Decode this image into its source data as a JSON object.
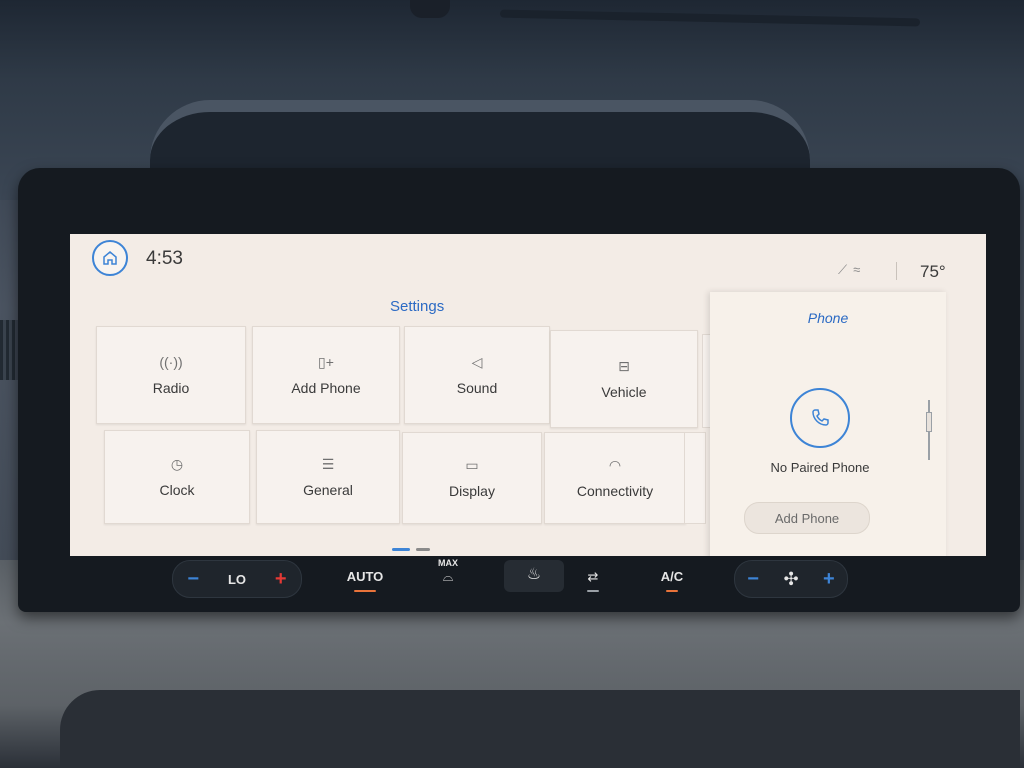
{
  "status_bar": {
    "time": "4:53",
    "temperature": "75°"
  },
  "settings": {
    "title": "Settings",
    "tiles": [
      {
        "label": "Radio",
        "icon": "radio-antenna-icon"
      },
      {
        "label": "Add Phone",
        "icon": "add-phone-icon"
      },
      {
        "label": "Sound",
        "icon": "speaker-icon"
      },
      {
        "label": "Vehicle",
        "icon": "vehicle-icon"
      },
      {
        "label": "Clock",
        "icon": "clock-icon"
      },
      {
        "label": "General",
        "icon": "sliders-icon"
      },
      {
        "label": "Display",
        "icon": "display-icon"
      },
      {
        "label": "Connectivity",
        "icon": "wifi-icon"
      }
    ]
  },
  "phone_panel": {
    "title": "Phone",
    "status": "No Paired Phone",
    "button_label": "Add Phone"
  },
  "climate": {
    "driver_temp": "LO",
    "auto_label": "AUTO",
    "max_label": "MAX",
    "ac_label": "A/C"
  },
  "colors": {
    "accent_blue": "#3d84d6",
    "indicator_orange": "#e8733a",
    "minus_blue": "#3d84d6",
    "plus_red": "#e53935"
  }
}
